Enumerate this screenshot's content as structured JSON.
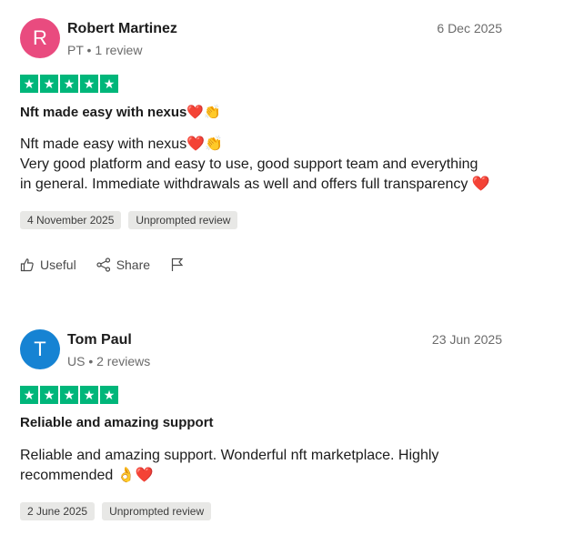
{
  "reviews": [
    {
      "avatar_letter": "R",
      "avatar_color": "#e94b7f",
      "name": "Robert Martinez",
      "meta": "PT • 1 review",
      "date": "6 Dec 2025",
      "rating": 5,
      "title": "Nft made easy with nexus❤️👏",
      "body_lines": [
        "Nft made easy with nexus❤️👏",
        "Very good platform and easy to use, good support team and everything",
        "in general. Immediate withdrawals as well and offers full transparency ❤️"
      ],
      "tags": [
        "4 November 2025",
        "Unprompted review"
      ],
      "actions": {
        "useful": "Useful",
        "share": "Share"
      }
    },
    {
      "avatar_letter": "T",
      "avatar_color": "#1683d3",
      "name": "Tom Paul",
      "meta": "US • 2 reviews",
      "date": "23 Jun 2025",
      "rating": 5,
      "title": "Reliable and amazing support",
      "body_lines": [
        "Reliable and amazing support. Wonderful nft marketplace. Highly",
        "recommended 👌❤️"
      ],
      "tags": [
        "2 June 2025",
        "Unprompted review"
      ]
    }
  ],
  "colors": {
    "star_green": "#00b67a"
  }
}
